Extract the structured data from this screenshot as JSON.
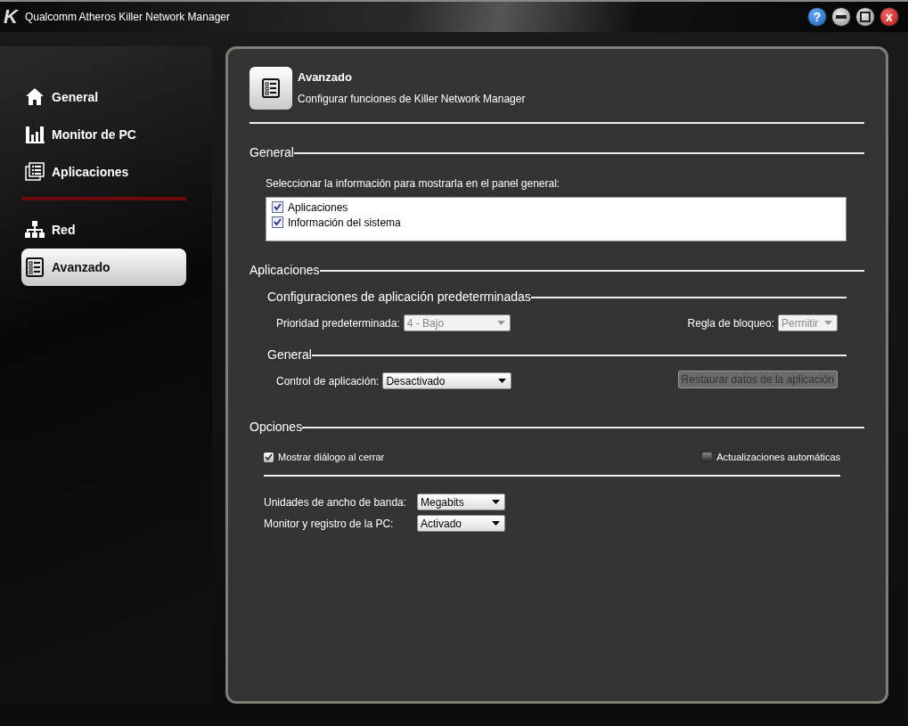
{
  "window": {
    "logo": "K",
    "title": "Qualcomm Atheros Killer Network Manager"
  },
  "title_buttons": [
    {
      "kind": "help",
      "glyph": "?"
    },
    {
      "kind": "minimize"
    },
    {
      "kind": "maximize"
    },
    {
      "kind": "close",
      "glyph": "x"
    }
  ],
  "sidebar": {
    "groups": [
      [
        {
          "label": "General",
          "selected": false
        },
        {
          "label": "Monitor de PC",
          "selected": false
        },
        {
          "label": "Aplicaciones",
          "selected": false
        }
      ],
      [
        {
          "label": "Red",
          "selected": false
        },
        {
          "label": "Avanzado",
          "selected": true
        }
      ]
    ]
  },
  "header": {
    "title": "Avanzado",
    "subtitle": "Configurar funciones de Killer Network Manager"
  },
  "general": {
    "heading": "General",
    "prompt": "Seleccionar la información para mostrarla en el panel general:",
    "items": [
      {
        "label": "Aplicaciones",
        "checked": true
      },
      {
        "label": "Información del sistema",
        "checked": true
      }
    ]
  },
  "applications": {
    "heading": "Aplicaciones",
    "defaults": {
      "heading": "Configuraciones de aplicación predeterminadas",
      "priority": {
        "label": "Prioridad predeterminada:",
        "value": "4 - Bajo",
        "disabled": true
      },
      "block_rule": {
        "label": "Regla de bloqueo:",
        "value": "Permitir",
        "disabled": true
      }
    },
    "general": {
      "heading": "General",
      "control": {
        "label": "Control de aplicación:",
        "value": "Desactivado",
        "disabled": false
      },
      "restore_button": {
        "label": "Restaurar datos de la aplicación",
        "disabled": true
      }
    }
  },
  "options": {
    "heading": "Opciones",
    "checks": [
      {
        "label": "Mostrar diálogo al cerrar",
        "checked": true
      },
      {
        "label": "Actualizaciones automáticas",
        "checked": false
      }
    ],
    "fields": [
      {
        "label": "Unidades de ancho de banda:",
        "value": "Megabits",
        "disabled": false
      },
      {
        "label": "Monitor y registro de la PC:",
        "value": "Activado",
        "disabled": false
      }
    ]
  }
}
